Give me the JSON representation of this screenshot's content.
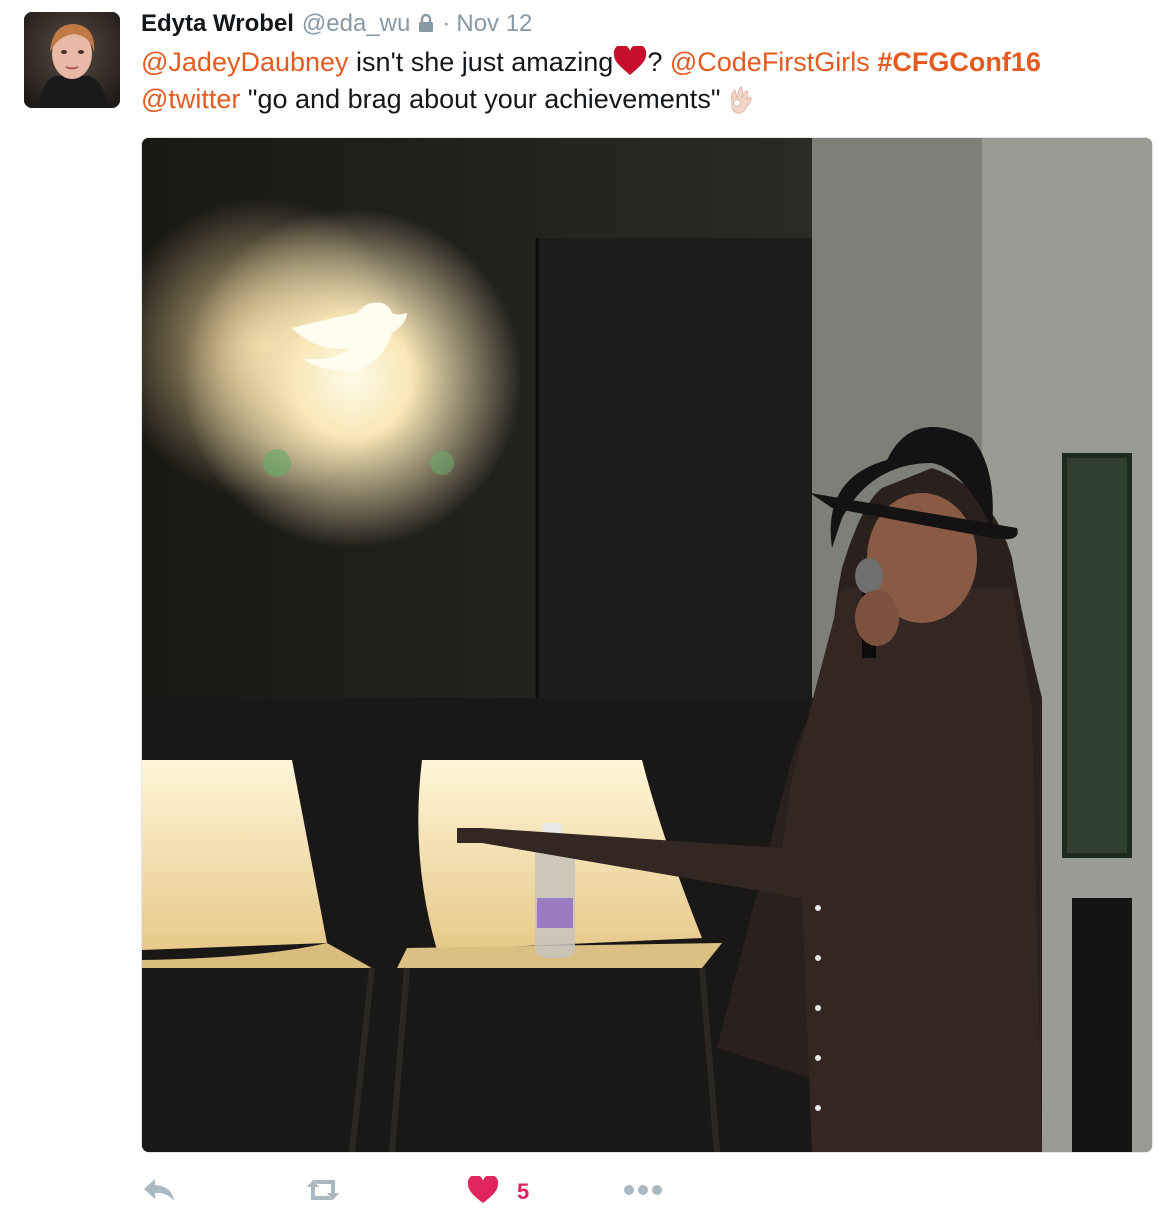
{
  "tweet": {
    "display_name": "Edyta Wrobel",
    "handle": "@eda_wu",
    "separator": "·",
    "timestamp": "Nov 12",
    "text": {
      "mention1": "@JadeyDaubney",
      "part1": " isn't she just amazing",
      "part2": "? ",
      "mention2": "@CodeFirstGirls",
      "hashtag": "#CFGConf16",
      "mention3": "@twitter",
      "quote": " \"go and brag about your achievements\""
    }
  },
  "actions": {
    "reply_icon": "reply-icon",
    "retweet_icon": "retweet-icon",
    "like_icon": "heart-icon",
    "like_count": "5",
    "more_icon": "more-dots-icon"
  },
  "colors": {
    "link": "#e45b21",
    "like": "#e0245e",
    "muted": "#8899a6",
    "icon": "#aab8c2"
  }
}
